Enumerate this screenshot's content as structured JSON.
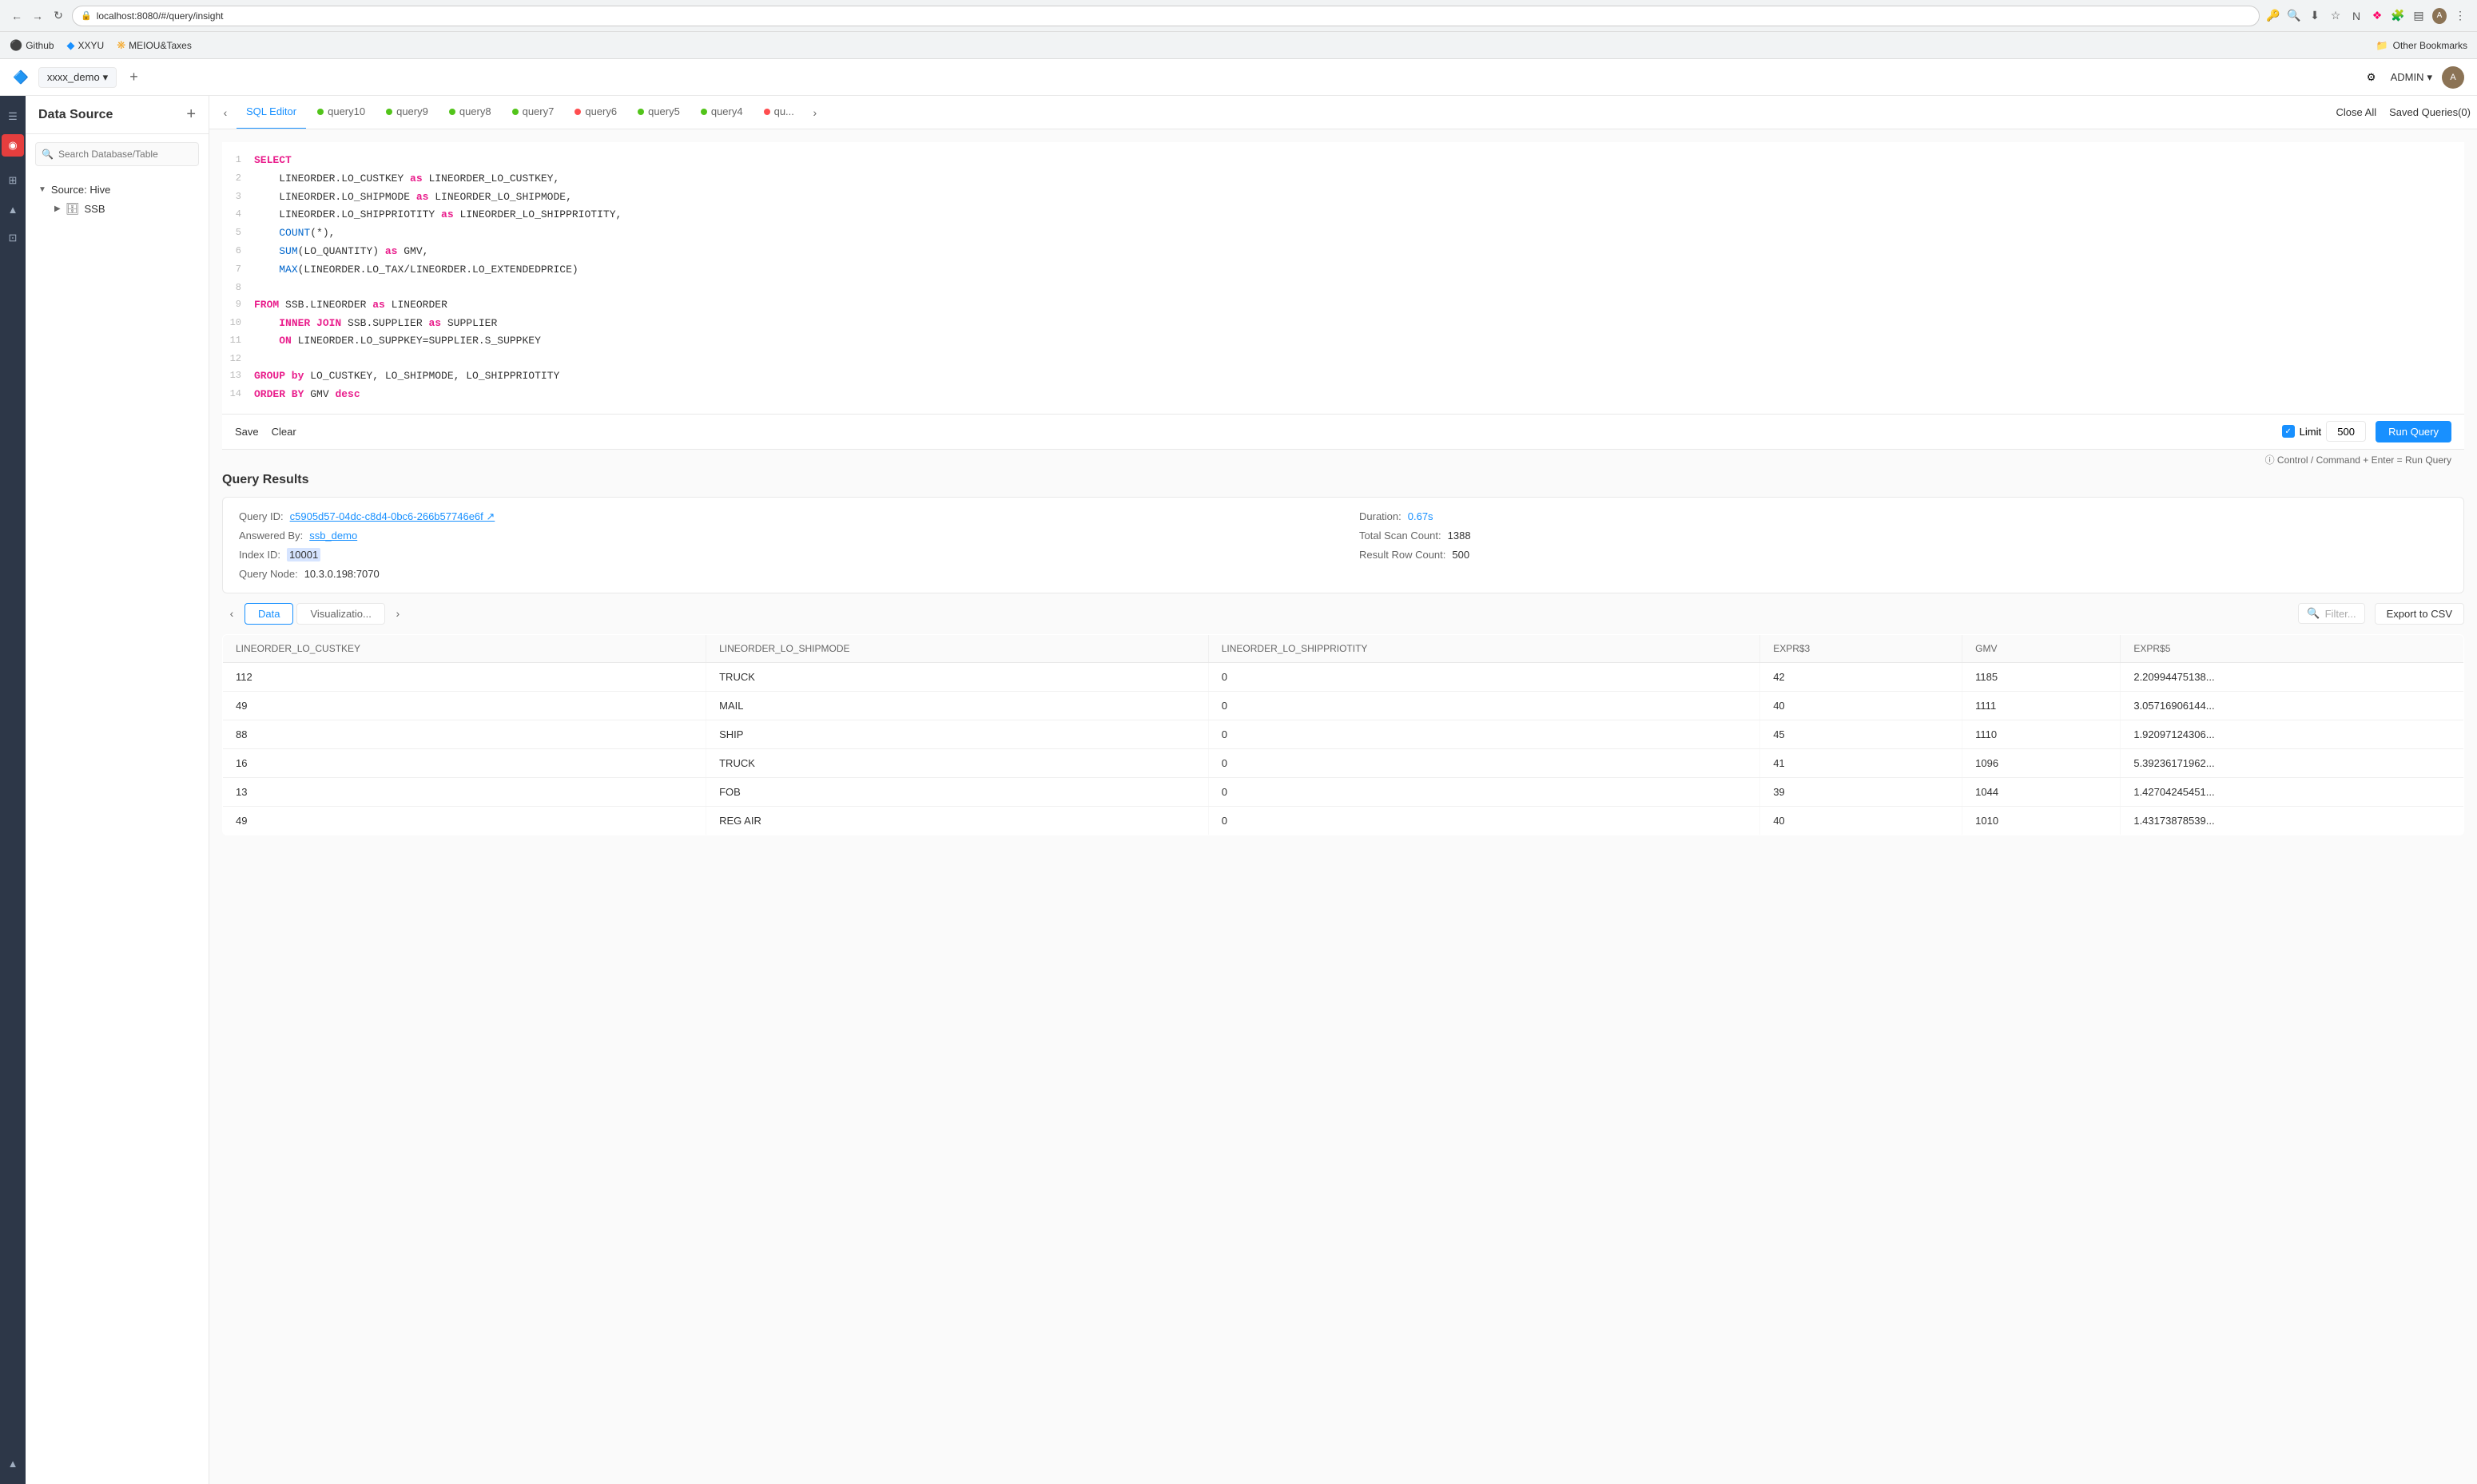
{
  "browser": {
    "url": "localhost:8080/#/query/insight",
    "bookmarks": [
      {
        "id": "github",
        "label": "Github",
        "icon": "⚫"
      },
      {
        "id": "xxyu",
        "label": "XXYU",
        "icon": "◆",
        "color": "#1890ff"
      },
      {
        "id": "meiou",
        "label": "MEIOU&Taxes",
        "icon": "❋",
        "color": "#f5a623"
      }
    ],
    "other_bookmarks": "Other Bookmarks"
  },
  "topbar": {
    "workspace": "xxxx_demo",
    "add_label": "+",
    "admin_label": "ADMIN",
    "chevron": "▾"
  },
  "sidebar": {
    "title": "Data Source",
    "add_icon": "+",
    "search_placeholder": "Search Database/Table",
    "tree": [
      {
        "label": "Source: Hive",
        "type": "source",
        "expanded": true
      },
      {
        "label": "SSB",
        "type": "database",
        "icon": "🗄",
        "indent": 1
      }
    ]
  },
  "tabs": {
    "items": [
      {
        "id": "sql-editor",
        "label": "SQL Editor",
        "dot": "none",
        "active": true
      },
      {
        "id": "query10",
        "label": "query10",
        "dot": "green"
      },
      {
        "id": "query9",
        "label": "query9",
        "dot": "green"
      },
      {
        "id": "query8",
        "label": "query8",
        "dot": "green"
      },
      {
        "id": "query7",
        "label": "query7",
        "dot": "green"
      },
      {
        "id": "query6",
        "label": "query6",
        "dot": "red"
      },
      {
        "id": "query5",
        "label": "query5",
        "dot": "green"
      },
      {
        "id": "query4",
        "label": "query4",
        "dot": "green"
      },
      {
        "id": "queryX",
        "label": "qu...",
        "dot": "red"
      }
    ],
    "close_all": "Close All",
    "saved_queries": "Saved Queries(0)"
  },
  "sql": {
    "lines": [
      {
        "num": 1,
        "content": "SELECT",
        "type": "keyword"
      },
      {
        "num": 2,
        "content": "    LINEORDER.LO_CUSTKEY as LINEORDER_LO_CUSTKEY,",
        "type": "mixed"
      },
      {
        "num": 3,
        "content": "    LINEORDER.LO_SHIPMODE as LINEORDER_LO_SHIPMODE,",
        "type": "mixed"
      },
      {
        "num": 4,
        "content": "    LINEORDER.LO_SHIPPRIOTITY as LINEORDER_LO_SHIPPRIOTITY,",
        "type": "mixed"
      },
      {
        "num": 5,
        "content": "    COUNT(*),",
        "type": "mixed"
      },
      {
        "num": 6,
        "content": "    SUM(LO_QUANTITY) as GMV,",
        "type": "mixed"
      },
      {
        "num": 7,
        "content": "    MAX(LINEORDER.LO_TAX/LINEORDER.LO_EXTENDEDPRICE)",
        "type": "mixed"
      },
      {
        "num": 8,
        "content": "",
        "type": "empty"
      },
      {
        "num": 9,
        "content": "FROM SSB.LINEORDER as LINEORDER",
        "type": "mixed"
      },
      {
        "num": 10,
        "content": "    INNER JOIN SSB.SUPPLIER as SUPPLIER",
        "type": "mixed"
      },
      {
        "num": 11,
        "content": "    ON LINEORDER.LO_SUPPKEY=SUPPLIER.S_SUPPKEY",
        "type": "mixed"
      },
      {
        "num": 12,
        "content": "",
        "type": "empty"
      },
      {
        "num": 13,
        "content": "GROUP by LO_CUSTKEY, LO_SHIPMODE, LO_SHIPPRIOTITY",
        "type": "mixed"
      },
      {
        "num": 14,
        "content": "ORDER BY GMV desc",
        "type": "mixed"
      }
    ]
  },
  "toolbar": {
    "save_label": "Save",
    "clear_label": "Clear",
    "limit_label": "Limit",
    "limit_value": "500",
    "run_label": "Run Query",
    "hint": "ⓘ Control / Command + Enter = Run Query"
  },
  "results": {
    "section_title": "Query Results",
    "meta": {
      "query_id_label": "Query ID:",
      "query_id_value": "c5905d57-04dc-c8d4-0bc6-266b57746e6f",
      "query_id_icon": "↗",
      "answered_by_label": "Answered By:",
      "answered_by_value": "ssb_demo",
      "index_id_label": "Index ID:",
      "index_id_value": "10001",
      "query_node_label": "Query Node:",
      "query_node_value": "10.3.0.198:7070",
      "duration_label": "Duration:",
      "duration_value": "0.67s",
      "total_scan_label": "Total Scan Count:",
      "total_scan_value": "1388",
      "result_row_label": "Result Row Count:",
      "result_row_value": "500"
    },
    "tabs": [
      {
        "id": "data",
        "label": "Data",
        "active": true
      },
      {
        "id": "visualization",
        "label": "Visualizatio...",
        "active": false
      }
    ],
    "filter_placeholder": "Filter...",
    "export_label": "Export to CSV",
    "columns": [
      "LINEORDER_LO_CUSTKEY",
      "LINEORDER_LO_SHIPMODE",
      "LINEORDER_LO_SHIPPRIOTITY",
      "EXPR$3",
      "GMV",
      "EXPR$5"
    ],
    "rows": [
      {
        "custkey": "112",
        "shipmode": "TRUCK",
        "shipprio": "0",
        "expr3": "42",
        "gmv": "1185",
        "expr5": "2.20994475138..."
      },
      {
        "custkey": "49",
        "shipmode": "MAIL",
        "shipprio": "0",
        "expr3": "40",
        "gmv": "1111",
        "expr5": "3.05716906144..."
      },
      {
        "custkey": "88",
        "shipmode": "SHIP",
        "shipprio": "0",
        "expr3": "45",
        "gmv": "1110",
        "expr5": "1.92097124306..."
      },
      {
        "custkey": "16",
        "shipmode": "TRUCK",
        "shipprio": "0",
        "expr3": "41",
        "gmv": "1096",
        "expr5": "5.39236171962..."
      },
      {
        "custkey": "13",
        "shipmode": "FOB",
        "shipprio": "0",
        "expr3": "39",
        "gmv": "1044",
        "expr5": "1.42704245451..."
      },
      {
        "custkey": "49",
        "shipmode": "REG AIR",
        "shipprio": "0",
        "expr3": "40",
        "gmv": "1010",
        "expr5": "1.43173878539..."
      }
    ]
  },
  "left_nav": {
    "items": [
      {
        "id": "menu",
        "icon": "☰"
      },
      {
        "id": "query",
        "icon": "◉",
        "active": true
      },
      {
        "id": "nav1",
        "icon": "⊞"
      },
      {
        "id": "nav2",
        "icon": "▲"
      },
      {
        "id": "nav3",
        "icon": "⊡"
      },
      {
        "id": "nav4",
        "icon": "▲"
      }
    ]
  }
}
